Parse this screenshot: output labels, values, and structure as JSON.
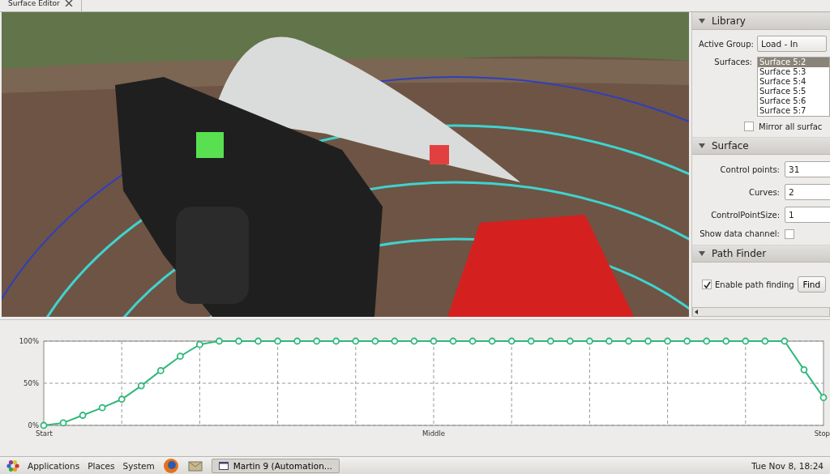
{
  "tab": {
    "title": "Surface Editor",
    "closable": true
  },
  "library": {
    "title": "Library",
    "expanded": true,
    "active_group_label": "Active Group:",
    "active_group_value": "Load - In",
    "surfaces_label": "Surfaces:",
    "surfaces": [
      {
        "label": "Surface 5:2",
        "selected": true
      },
      {
        "label": "Surface 5:3",
        "selected": false
      },
      {
        "label": "Surface 5:4",
        "selected": false
      },
      {
        "label": "Surface 5:5",
        "selected": false
      },
      {
        "label": "Surface 5:6",
        "selected": false
      },
      {
        "label": "Surface 5:7",
        "selected": false
      }
    ],
    "mirror": {
      "label": "Mirror all surfac",
      "checked": false
    }
  },
  "surface": {
    "title": "Surface",
    "expanded": true,
    "fields": [
      {
        "label": "Control points:",
        "value": "31"
      },
      {
        "label": "Curves:",
        "value": "2"
      },
      {
        "label": "ControlPointSize:",
        "value": "1"
      }
    ],
    "show_data_channel": {
      "label": "Show data channel:",
      "checked": false
    }
  },
  "path_finder": {
    "title": "Path Finder",
    "expanded": true,
    "enable": {
      "label": "Enable path finding",
      "checked": true
    },
    "button": "Find"
  },
  "chart_data": {
    "type": "line",
    "categories": [
      "Start",
      null,
      null,
      null,
      null,
      null,
      null,
      null,
      null,
      null,
      null,
      null,
      null,
      null,
      null,
      null,
      null,
      null,
      null,
      null,
      "Middle",
      null,
      null,
      null,
      null,
      null,
      null,
      null,
      null,
      null,
      null,
      null,
      null,
      null,
      null,
      null,
      null,
      null,
      null,
      null,
      "Stop"
    ],
    "grid": true,
    "series": [
      {
        "color": "#2fb87a",
        "marker": "circle",
        "values": [
          0,
          3,
          12,
          21,
          31,
          47,
          65,
          82,
          96,
          100,
          100,
          100,
          100,
          100,
          100,
          100,
          100,
          100,
          100,
          100,
          100,
          100,
          100,
          100,
          100,
          100,
          100,
          100,
          100,
          100,
          100,
          100,
          100,
          100,
          100,
          100,
          100,
          100,
          100,
          66,
          33
        ]
      }
    ],
    "ylim": [
      0,
      100
    ],
    "yticks": [
      {
        "value": 0,
        "label": "0%"
      },
      {
        "value": 50,
        "label": "50%"
      },
      {
        "value": 100,
        "label": "100%"
      }
    ]
  },
  "taskbar": {
    "menus": [
      "Applications",
      "Places",
      "System"
    ],
    "window_button": "Martin  9 (Automation...",
    "clock": "Tue Nov  8, 18:24"
  }
}
